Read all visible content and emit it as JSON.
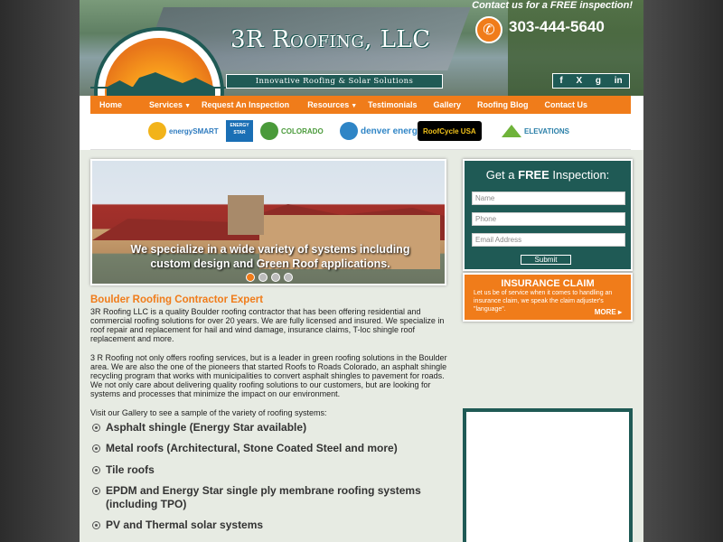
{
  "header": {
    "cta_text": "Contact us for a FREE inspection!",
    "phone": "303-444-5640",
    "company_name": "3R Roofing, LLC",
    "tagline": "Innovative Roofing & Solar Solutions",
    "social": [
      "f",
      "X",
      "g",
      "in"
    ]
  },
  "nav": {
    "items": [
      {
        "label": "Home",
        "dropdown": false
      },
      {
        "label": "Services",
        "dropdown": true
      },
      {
        "label": "Request An Inspection",
        "dropdown": false
      },
      {
        "label": "Resources",
        "dropdown": true
      },
      {
        "label": "Testimonials",
        "dropdown": false
      },
      {
        "label": "Gallery",
        "dropdown": false
      },
      {
        "label": "Roofing Blog",
        "dropdown": false
      },
      {
        "label": "Contact Us",
        "dropdown": false
      }
    ]
  },
  "partners": [
    {
      "name": "energySMART",
      "color": "#2e7bbf"
    },
    {
      "name": "ENERGY STAR",
      "color": "#1a6fb5"
    },
    {
      "name": "COLORADO",
      "color": "#4a9a3a"
    },
    {
      "name": "denver energy",
      "color": "#2f85c6"
    },
    {
      "name": "RoofCycle USA",
      "color": "#000000"
    },
    {
      "name": "ELEVATIONS",
      "color": "#2a7fa8"
    }
  ],
  "slider": {
    "caption_line1": "We specialize in a wide variety of systems including",
    "caption_line2": "custom design and Green Roof applications.",
    "dots": 4,
    "active_dot": 1
  },
  "inspection_form": {
    "title_pre": "Get a ",
    "title_bold": "FREE",
    "title_post": " Inspection:",
    "name_placeholder": "Name",
    "phone_placeholder": "Phone",
    "email_placeholder": "Email Address",
    "submit_label": "Submit"
  },
  "insurance": {
    "title": "INSURANCE CLAIM",
    "text": "Let us be of service when it comes to handling an insurance claim, we speak the claim adjuster's \"language\".",
    "more": "MORE"
  },
  "content": {
    "heading": "Boulder Roofing Contractor Expert",
    "para1": "3R Roofing LLC is a quality Boulder roofing contractor that has been offering residential and commercial roofing solutions for over 20 years.  We are fully licensed and insured. We specialize in roof repair and replacement for hail and wind damage, insurance claims, T-loc shingle roof replacement and more.",
    "para2": "3 R Roofing not only offers roofing services, but is a leader in green roofing solutions in the Boulder area.  We are also the one of the pioneers that started Roofs to Roads Colorado, an asphalt shingle recycling program that works with municipalities to convert asphalt shingles to pavement for roads.  We not only care about delivering quality roofing solutions to our customers, but are looking for systems and processes that minimize the impact on our environment.",
    "para3": "Visit our Gallery to see a sample of the variety of roofing systems:",
    "list": [
      "Asphalt shingle (Energy Star available)",
      "Metal roofs (Architectural, Stone Coated Steel and more)",
      "Tile roofs",
      "EPDM and Energy Star single ply membrane roofing systems (including TPO)",
      "PV and Thermal solar systems"
    ]
  },
  "colors": {
    "accent": "#f07c1a",
    "brand": "#1f5a55"
  }
}
